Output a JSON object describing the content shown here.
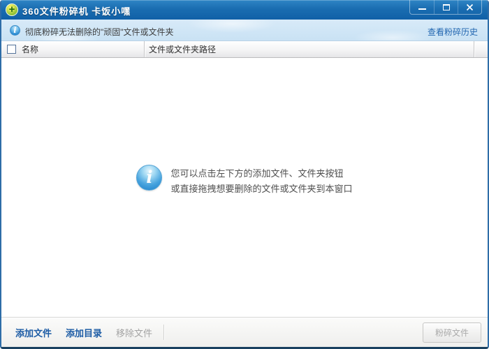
{
  "window": {
    "title": "360文件粉碎机 卡饭小嘿"
  },
  "title_bar": {
    "icons": {
      "app": "green-circle-plus-360-icon",
      "minimize": "minimize-dash",
      "maximize": "maximize-square",
      "close": "close-x"
    },
    "app_icon_glyph": "+"
  },
  "info_bar": {
    "icon": "info-i-blue-circle",
    "icon_glyph": "i",
    "message": "彻底粉碎无法删除的\"顽固\"文件或文件夹",
    "history_link": "查看粉碎历史"
  },
  "table": {
    "select_all_checked": false,
    "columns": [
      {
        "label": "名称"
      },
      {
        "label": "文件或文件夹路径"
      }
    ],
    "rows": []
  },
  "empty_state": {
    "icon": "info-i-blue-circle-large",
    "icon_glyph": "i",
    "lines": [
      "您可以点击左下方的添加文件、文件夹按钮",
      "或直接拖拽想要删除的文件或文件夹到本窗口"
    ]
  },
  "toolbar": {
    "add_file_label": "添加文件",
    "add_dir_label": "添加目录",
    "remove_file_label": "移除文件",
    "remove_file_enabled": false,
    "shred_label": "粉碎文件",
    "shred_enabled": false
  },
  "colors": {
    "title_bar_blue": "#1a6db1",
    "info_bar_blue": "#cfe4f4",
    "link_blue": "#2166b0",
    "button_text_blue": "#1d5ca5",
    "disabled_gray": "#a3a3a3",
    "window_border": "#2e6da8"
  }
}
